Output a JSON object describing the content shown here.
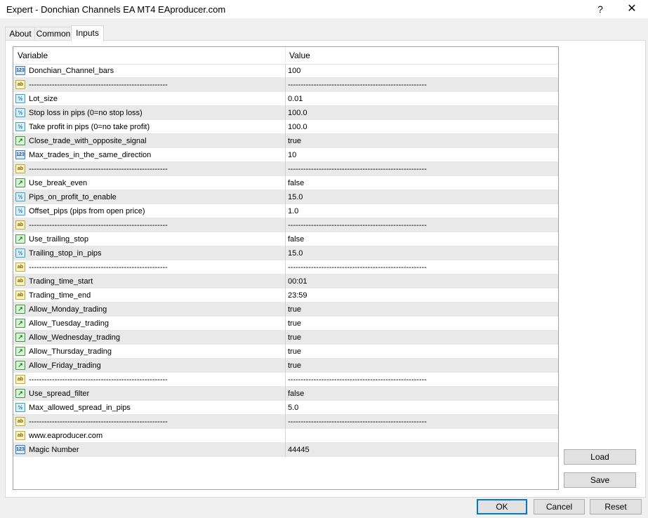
{
  "window": {
    "title": "Expert - Donchian Channels EA MT4 EAproducer.com",
    "help_label": "?",
    "close_label": "✕"
  },
  "tabs": [
    {
      "label": "About"
    },
    {
      "label": "Common"
    },
    {
      "label": "Inputs"
    }
  ],
  "grid": {
    "headers": {
      "variable": "Variable",
      "value": "Value"
    },
    "rows": [
      {
        "type": "int",
        "icon": "123",
        "name": "Donchian_Channel_bars",
        "value": "100"
      },
      {
        "type": "string",
        "icon": "ab",
        "name": "------------------------------------------------------",
        "value": "------------------------------------------------------"
      },
      {
        "type": "double",
        "icon": "½",
        "name": "Lot_size",
        "value": "0.01"
      },
      {
        "type": "double",
        "icon": "½",
        "name": "Stop loss in pips (0=no stop loss)",
        "value": "100.0"
      },
      {
        "type": "double",
        "icon": "½",
        "name": "Take profit in pips (0=no take profit)",
        "value": "100.0"
      },
      {
        "type": "bool",
        "icon": "↗",
        "name": "Close_trade_with_opposite_signal",
        "value": "true"
      },
      {
        "type": "int",
        "icon": "123",
        "name": "Max_trades_in_the_same_direction",
        "value": "10"
      },
      {
        "type": "string",
        "icon": "ab",
        "name": "------------------------------------------------------",
        "value": "------------------------------------------------------"
      },
      {
        "type": "bool",
        "icon": "↗",
        "name": "Use_break_even",
        "value": "false"
      },
      {
        "type": "double",
        "icon": "½",
        "name": "Pips_on_profit_to_enable",
        "value": "15.0"
      },
      {
        "type": "double",
        "icon": "½",
        "name": "Offset_pips (pips from open price)",
        "value": "1.0"
      },
      {
        "type": "string",
        "icon": "ab",
        "name": "------------------------------------------------------",
        "value": "------------------------------------------------------"
      },
      {
        "type": "bool",
        "icon": "↗",
        "name": "Use_trailing_stop",
        "value": "false"
      },
      {
        "type": "double",
        "icon": "½",
        "name": "Trailing_stop_in_pips",
        "value": "15.0"
      },
      {
        "type": "string",
        "icon": "ab",
        "name": "------------------------------------------------------",
        "value": "------------------------------------------------------"
      },
      {
        "type": "string",
        "icon": "ab",
        "name": "Trading_time_start",
        "value": "00:01"
      },
      {
        "type": "string",
        "icon": "ab",
        "name": "Trading_time_end",
        "value": "23:59"
      },
      {
        "type": "bool",
        "icon": "↗",
        "name": "Allow_Monday_trading",
        "value": "true"
      },
      {
        "type": "bool",
        "icon": "↗",
        "name": "Allow_Tuesday_trading",
        "value": "true"
      },
      {
        "type": "bool",
        "icon": "↗",
        "name": "Allow_Wednesday_trading",
        "value": "true"
      },
      {
        "type": "bool",
        "icon": "↗",
        "name": "Allow_Thursday_trading",
        "value": "true"
      },
      {
        "type": "bool",
        "icon": "↗",
        "name": "Allow_Friday_trading",
        "value": "true"
      },
      {
        "type": "string",
        "icon": "ab",
        "name": "------------------------------------------------------",
        "value": "------------------------------------------------------"
      },
      {
        "type": "bool",
        "icon": "↗",
        "name": "Use_spread_filter",
        "value": "false"
      },
      {
        "type": "double",
        "icon": "½",
        "name": "Max_allowed_spread_in_pips",
        "value": "5.0"
      },
      {
        "type": "string",
        "icon": "ab",
        "name": "------------------------------------------------------",
        "value": "------------------------------------------------------"
      },
      {
        "type": "string",
        "icon": "ab",
        "name": "www.eaproducer.com",
        "value": ""
      },
      {
        "type": "int",
        "icon": "123",
        "name": "Magic Number",
        "value": "44445"
      }
    ]
  },
  "side_buttons": {
    "load": "Load",
    "save": "Save"
  },
  "footer_buttons": {
    "ok": "OK",
    "cancel": "Cancel",
    "reset": "Reset"
  },
  "colors": {
    "accent": "#0078d7",
    "row_alt": "#e9e9e9",
    "button_bg": "#e1e1e1"
  }
}
